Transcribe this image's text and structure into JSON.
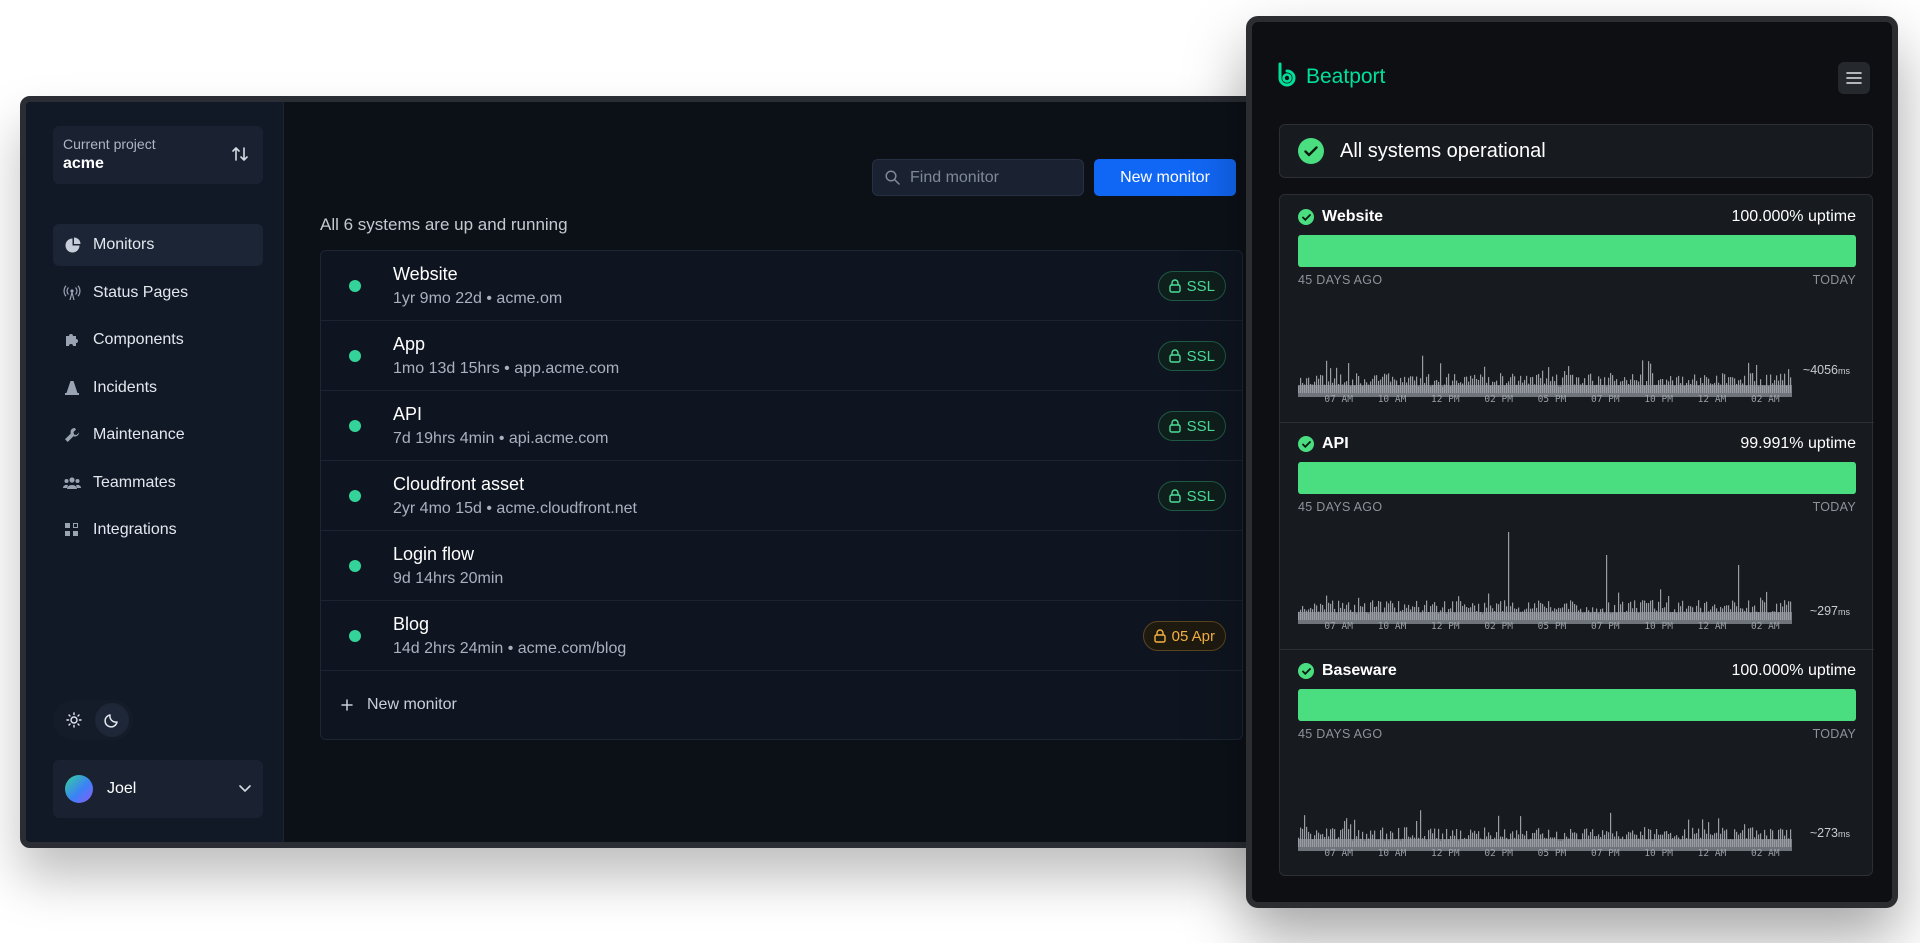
{
  "dashboard": {
    "project": {
      "label": "Current project",
      "value": "acme"
    },
    "nav": [
      {
        "label": "Monitors",
        "icon": "monitor-gauge-icon",
        "active": true
      },
      {
        "label": "Status Pages",
        "icon": "broadcast-icon"
      },
      {
        "label": "Components",
        "icon": "puzzle-icon"
      },
      {
        "label": "Incidents",
        "icon": "cone-icon"
      },
      {
        "label": "Maintenance",
        "icon": "wrench-icon"
      },
      {
        "label": "Teammates",
        "icon": "people-icon"
      },
      {
        "label": "Integrations",
        "icon": "grid-icon"
      }
    ],
    "user": {
      "name": "Joel"
    },
    "search_placeholder": "Find monitor",
    "new_monitor_label": "New monitor",
    "summary": "All 6 systems are up and running",
    "monitors": [
      {
        "title": "Website",
        "sub": "1yr 9mo 22d • acme.om",
        "badge": "SSL"
      },
      {
        "title": "App",
        "sub": "1mo 13d 15hrs • app.acme.com",
        "badge": "SSL"
      },
      {
        "title": "API",
        "sub": "7d 19hrs 4min • api.acme.com",
        "badge": "SSL"
      },
      {
        "title": "Cloudfront asset",
        "sub": "2yr 4mo 15d • acme.cloudfront.net",
        "badge": "SSL"
      },
      {
        "title": "Login flow",
        "sub": "9d 14hrs 20min",
        "badge": ""
      },
      {
        "title": "Blog",
        "sub": "14d 2hrs 24min • acme.com/blog",
        "badge": "05 Apr"
      }
    ],
    "add_monitor_label": "New monitor",
    "colors": {
      "accent": "#1167f5",
      "up": "#34d399",
      "warn": "#f5b142"
    }
  },
  "status_page": {
    "brand": "Beatport",
    "banner": "All systems operational",
    "services": [
      {
        "name": "Website",
        "uptime": "100.000% uptime",
        "from": "45 DAYS AGO",
        "to": "TODAY",
        "latency": "~4056",
        "unit": "ms"
      },
      {
        "name": "API",
        "uptime": "99.991% uptime",
        "from": "45 DAYS AGO",
        "to": "TODAY",
        "latency": "~297",
        "unit": "ms"
      },
      {
        "name": "Baseware",
        "uptime": "100.000% uptime",
        "from": "45 DAYS AGO",
        "to": "TODAY",
        "latency": "~273",
        "unit": "ms"
      }
    ],
    "time_ticks": [
      "07 AM",
      "10 AM",
      "12 PM",
      "02 PM",
      "05 PM",
      "07 PM",
      "10 PM",
      "12 AM",
      "02 AM"
    ],
    "colors": {
      "brand": "#00e09b",
      "uptime_bar": "#4ade80"
    }
  }
}
